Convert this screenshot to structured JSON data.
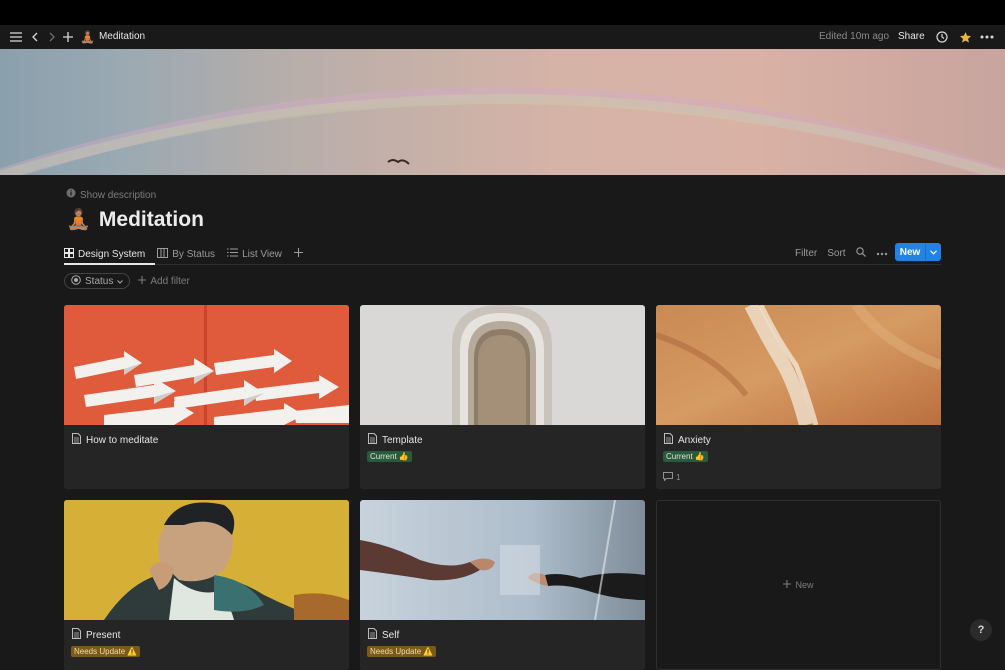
{
  "topbar": {
    "page_title": "Meditation",
    "page_emoji": "🧘🏽",
    "edited": "Edited 10m ago",
    "share": "Share"
  },
  "header": {
    "show_description": "Show description",
    "title": "Meditation",
    "emoji": "🧘🏽"
  },
  "views": {
    "tabs": [
      {
        "label": "Design System",
        "icon": "gallery-icon",
        "active": true
      },
      {
        "label": "By Status",
        "icon": "board-icon",
        "active": false
      },
      {
        "label": "List View",
        "icon": "list-icon",
        "active": false
      }
    ]
  },
  "toolbar": {
    "filter": "Filter",
    "sort": "Sort",
    "new": "New"
  },
  "filters": {
    "status": "Status",
    "add_filter": "Add filter"
  },
  "cards": [
    {
      "title": "How to meditate",
      "tag": "",
      "comments": ""
    },
    {
      "title": "Template",
      "tag": "Current 👍",
      "comments": ""
    },
    {
      "title": "Anxiety",
      "tag": "Current 👍",
      "comments": "1"
    },
    {
      "title": "Present",
      "tag": "Needs Update ⚠️",
      "comments": ""
    },
    {
      "title": "Self",
      "tag": "Needs Update ⚠️",
      "comments": ""
    }
  ],
  "new_card": "New",
  "help": "?",
  "colors": {
    "accent": "#2383e2",
    "background": "#191919",
    "card": "#252525",
    "tag_current": "#2b5a3a",
    "tag_warn": "#7a5a1a"
  }
}
